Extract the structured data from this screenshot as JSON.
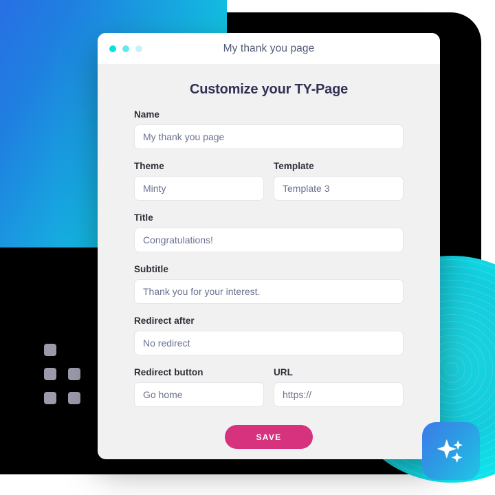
{
  "window": {
    "title": "My thank you page",
    "traffic_lights": [
      {
        "name": "dot-cyan-bright",
        "color": "#0ae0e0"
      },
      {
        "name": "dot-cyan-medium",
        "color": "#64e8ec"
      },
      {
        "name": "dot-cyan-light",
        "color": "#c4f4f7"
      }
    ]
  },
  "form": {
    "heading": "Customize your TY-Page",
    "fields": [
      {
        "label": "Name",
        "value": "My thank you page",
        "placeholder": "My thank you page"
      },
      {
        "label": "Theme",
        "value": "Minty",
        "placeholder": "Minty"
      },
      {
        "label": "Template",
        "value": "Template 3",
        "placeholder": "Template 3"
      },
      {
        "label": "Title",
        "value": "Congratulations!",
        "placeholder": "Congratulations!"
      },
      {
        "label": "Subtitle",
        "value": "Thank you for your interest.",
        "placeholder": "Thank you for your interest."
      },
      {
        "label": "Redirect after",
        "value": "No redirect",
        "placeholder": "No redirect"
      },
      {
        "label": "Redirect button",
        "value": "Go home",
        "placeholder": "Go home"
      },
      {
        "label": "URL",
        "value": "https://",
        "placeholder": "https://"
      }
    ],
    "save_label": "SAVE"
  },
  "decorations": {
    "sparkle_icon": "sparkles-icon",
    "blue_gradient_card": "#2f63e8",
    "teal_circle": "#13ccdd",
    "badge_gradient_start": "#3d7ae8",
    "badge_gradient_end": "#1fc6e6",
    "save_button_color": "#d6327e",
    "dot_grid_color": "#9a9aaa",
    "backdrop_color": "#000000"
  }
}
